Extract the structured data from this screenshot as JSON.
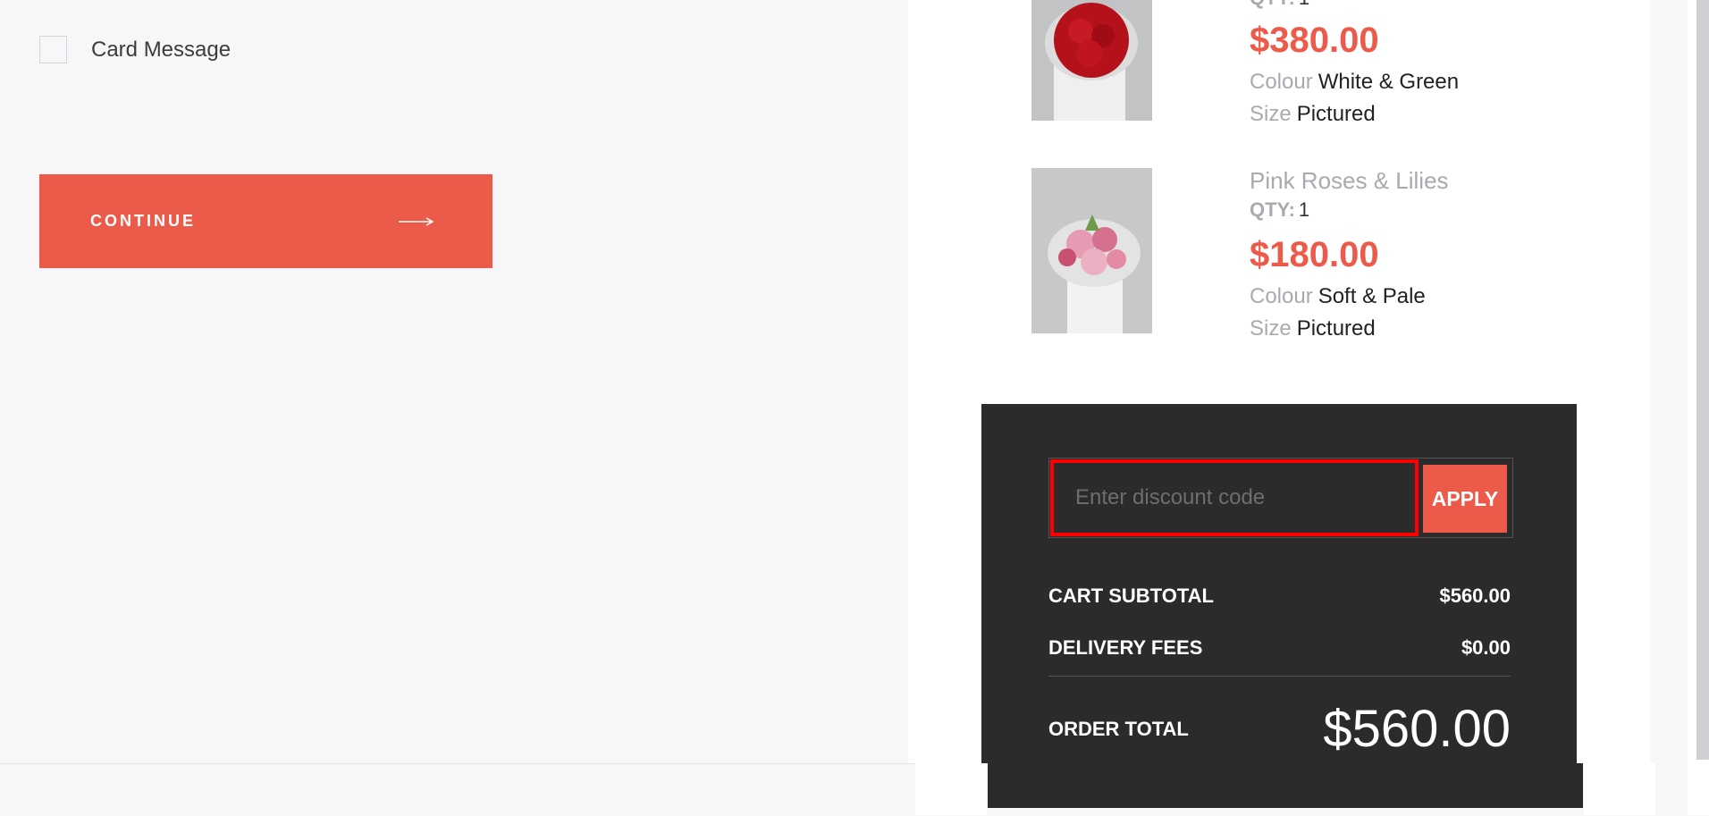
{
  "form": {
    "card_message_label": "Card Message",
    "card_message_checked": false,
    "continue_label": "CONTINUE"
  },
  "cart": {
    "items": [
      {
        "name": "",
        "qty_label": "QTY:",
        "qty": "1",
        "price": "$380.00",
        "colour_label": "Colour",
        "colour": "White & Green",
        "size_label": "Size",
        "size": "Pictured"
      },
      {
        "name": "Pink Roses & Lilies",
        "qty_label": "QTY:",
        "qty": "1",
        "price": "$180.00",
        "colour_label": "Colour",
        "colour": "Soft & Pale",
        "size_label": "Size",
        "size": "Pictured"
      }
    ]
  },
  "summary": {
    "discount_placeholder": "Enter discount code",
    "discount_value": "",
    "apply_label": "APPLY",
    "subtotal_label": "CART SUBTOTAL",
    "subtotal_value": "$560.00",
    "delivery_label": "DELIVERY FEES",
    "delivery_value": "$0.00",
    "total_label": "ORDER TOTAL",
    "total_value": "$560.00"
  },
  "colors": {
    "accent": "#ec5a4a",
    "summary_bg": "#2b2b2b",
    "highlight": "#ff0000"
  }
}
